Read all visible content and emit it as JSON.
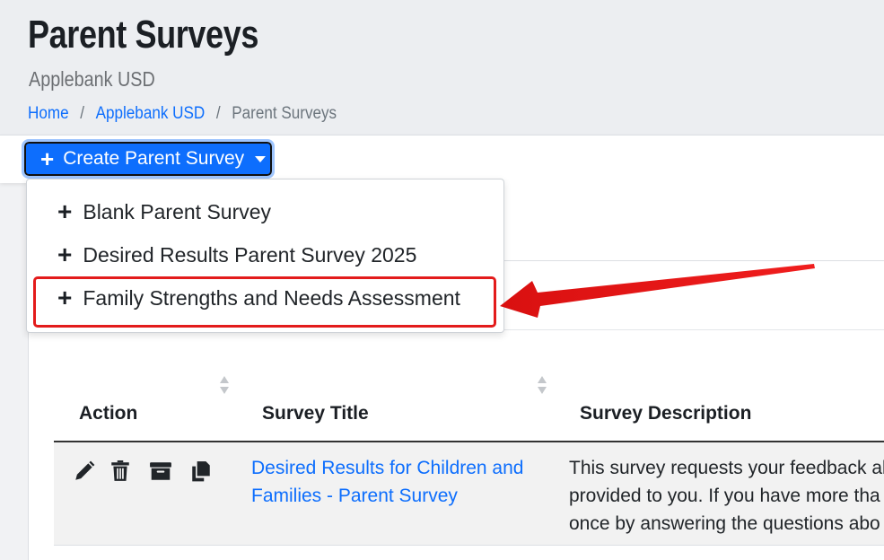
{
  "header": {
    "title": "Parent Surveys",
    "subtitle": "Applebank USD",
    "breadcrumb": [
      "Home",
      "Applebank USD",
      "Parent Surveys"
    ]
  },
  "toolbar": {
    "create_label": "Create Parent Survey"
  },
  "dropdown": {
    "items": [
      "Blank Parent Survey",
      "Desired Results Parent Survey 2025",
      "Family Strengths and Needs Assessment"
    ],
    "highlighted_index": 2
  },
  "table": {
    "headers": [
      "Action",
      "Survey Title",
      "Survey Description"
    ],
    "rows": [
      {
        "title": "Desired Results for Children and Families - Parent Survey",
        "description_lines": [
          "This survey requests your feedback al",
          "provided to you. If you have more tha",
          "once by answering the questions abo"
        ],
        "actions": [
          "edit-icon",
          "delete-icon",
          "archive-icon",
          "copy-icon"
        ]
      }
    ]
  },
  "colors": {
    "primary": "#0d6efd",
    "annotation": "#e31b1b"
  }
}
